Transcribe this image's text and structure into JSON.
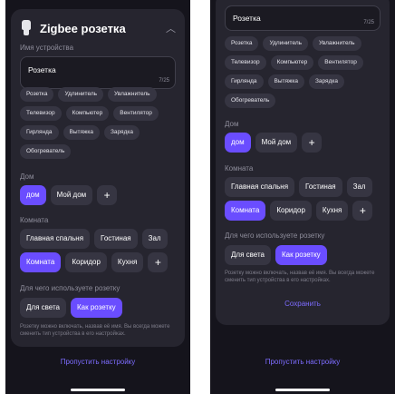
{
  "header": {
    "title": "Zigbee розетка",
    "collapse_icon": "chevron-up-icon"
  },
  "name_section": {
    "label": "Имя устройства",
    "value": "Розетка",
    "counter": "7/25"
  },
  "suggestions": [
    "Розетка",
    "Удлинитель",
    "Увлажнитель",
    "Телевизор",
    "Компьютер",
    "Вентилятор",
    "Гирлянда",
    "Вытяжка",
    "Зарядка",
    "Обогреватель"
  ],
  "home_section": {
    "label": "Дом",
    "options": [
      "дом",
      "Мой дом"
    ],
    "selected": "дом",
    "add": "+"
  },
  "room_section": {
    "label": "Комната",
    "row1": [
      "Главная спальня",
      "Гостиная",
      "Зал"
    ],
    "row2": [
      "Комната",
      "Коридор",
      "Кухня"
    ],
    "selected": "Комната",
    "add": "+"
  },
  "usage_section": {
    "label": "Для чего используете розетку",
    "options": [
      "Для света",
      "Как розетку"
    ],
    "selected": "Как розетку",
    "hint": "Розетку можно включать, назвав её имя. Вы всегда можете сменить тип устройства в его настройках."
  },
  "actions": {
    "save": "Сохранить",
    "skip": "Пропустить настройку"
  },
  "colors": {
    "accent": "#6a4dff",
    "link": "#7d6cff",
    "background": "#15141c",
    "card": "#26252f"
  }
}
